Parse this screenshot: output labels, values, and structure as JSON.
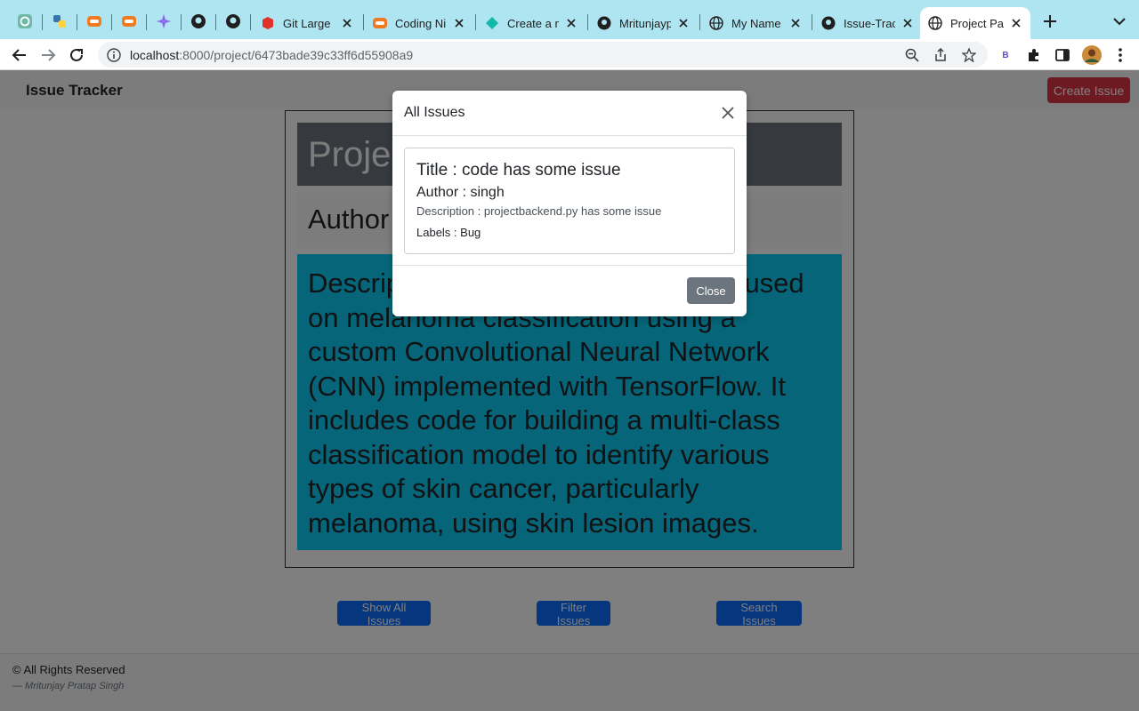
{
  "browser": {
    "tabs": [
      {
        "title": "Git Large F",
        "icon": "red-box-icon"
      },
      {
        "title": "Coding Nin",
        "icon": "coding-ninjas-icon"
      },
      {
        "title": "Create a ne",
        "icon": "diamond-icon"
      },
      {
        "title": "Mritunjayp",
        "icon": "github-icon"
      },
      {
        "title": "My Name",
        "icon": "globe-icon"
      },
      {
        "title": "Issue-Trac",
        "icon": "github-icon"
      },
      {
        "title": "Project Pag",
        "icon": "globe-icon",
        "active": true
      }
    ],
    "url_host": "localhost",
    "url_path": ":8000/project/6473bade39c33ff6d55908a9",
    "profile_badge": "B"
  },
  "navbar": {
    "brand": "Issue Tracker",
    "create_button": "Create Issue"
  },
  "project": {
    "header": "Project",
    "author": "Author",
    "description": "Description : This is a repository focused on melanoma classification using a custom Convolutional Neural Network (CNN) implemented with TensorFlow. It includes code for building a multi-class classification model to identify various types of skin cancer, particularly melanoma, using skin lesion images."
  },
  "actions": {
    "show_all": "Show All Issues",
    "filter": "Filter Issues",
    "search": "Search Issues"
  },
  "footer": {
    "rights": "© All Rights Reserved",
    "author": "— Mritunjay Pratap Singh"
  },
  "modal": {
    "title": "All Issues",
    "issue": {
      "title": "Title : code has some issue",
      "author": "Author : singh",
      "description": "Description : projectbackend.py has some issue",
      "labels": "Labels : Bug"
    },
    "close_button": "Close"
  },
  "colors": {
    "tabstrip": "#aee5f0",
    "create_button": "#dc3545",
    "description_bg": "#0dcaf0",
    "action_button": "#0d6efd",
    "close_button": "#6c757d"
  }
}
